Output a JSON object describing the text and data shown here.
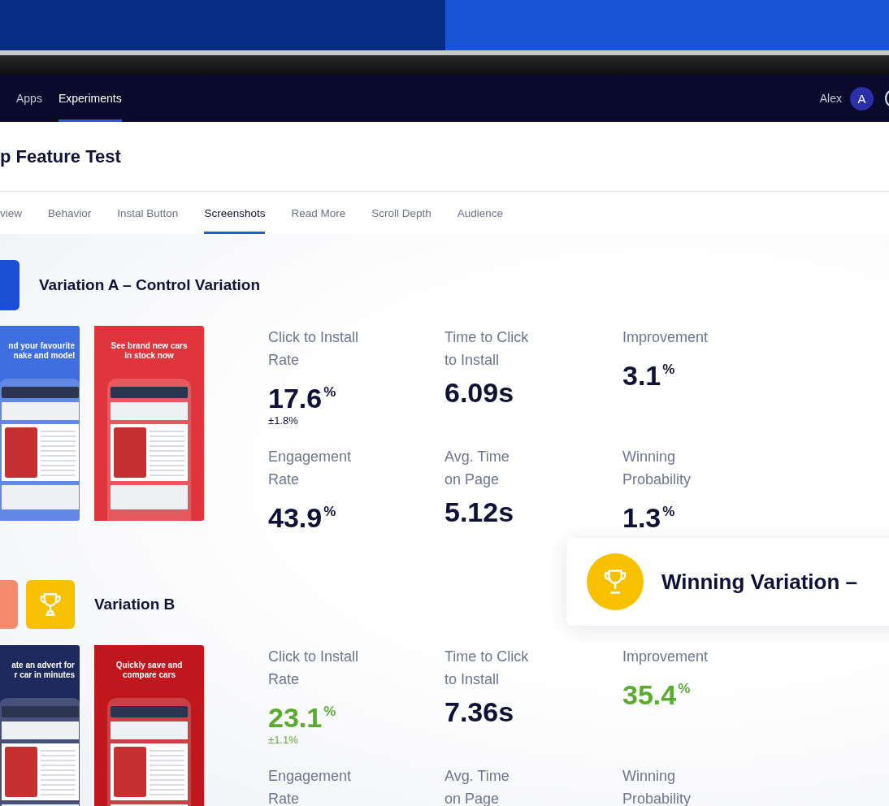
{
  "nav": {
    "items": [
      {
        "label": "Apps",
        "selected": false
      },
      {
        "label": "Experiments",
        "selected": true
      }
    ],
    "user": "Alex",
    "avatar": "A"
  },
  "page_title": "p Feature Test",
  "tabs": [
    {
      "label": "view",
      "selected": false
    },
    {
      "label": "Behavior",
      "selected": false
    },
    {
      "label": "Instal Button",
      "selected": false
    },
    {
      "label": "Screenshots",
      "selected": true
    },
    {
      "label": "Read More",
      "selected": false
    },
    {
      "label": "Scroll Depth",
      "selected": false
    },
    {
      "label": "Audience",
      "selected": false
    }
  ],
  "variations": [
    {
      "title": "Variation A – Control Variation",
      "color": "#1c4fd6",
      "trophy": false,
      "screenshots": [
        {
          "caption": "nd your favourite\nnake and model",
          "color": "#3f6fde"
        },
        {
          "caption": "See brand new cars\nin stock now",
          "color": "#e0353c"
        }
      ],
      "metrics": [
        {
          "label": "Click to Install\nRate",
          "value": "17.6",
          "unit": "%",
          "margin": "±1.8%",
          "positive": false
        },
        {
          "label": "Time to Click\nto Install",
          "value": "6.09s",
          "positive": false
        },
        {
          "label": "Improvement",
          "value": "3.1",
          "unit": "%",
          "positive": false
        },
        {
          "label": "Engagement\nRate",
          "value": "43.9",
          "unit": "%",
          "positive": false
        },
        {
          "label": "Avg. Time\non Page",
          "value": "5.12s",
          "positive": false
        },
        {
          "label": "Winning\nProbability",
          "value": "1.3",
          "unit": "%",
          "positive": false
        }
      ]
    },
    {
      "title": "Variation B",
      "color": "#f58a6c",
      "trophy": true,
      "screenshots": [
        {
          "caption": "ate an advert for\nr car in minutes",
          "color": "#1e2a5e"
        },
        {
          "caption": "Quickly save and\ncompare cars",
          "color": "#c0161d"
        }
      ],
      "metrics": [
        {
          "label": "Click to Install\nRate",
          "value": "23.1",
          "unit": "%",
          "margin": "±1.1%",
          "positive": true
        },
        {
          "label": "Time to Click\nto Install",
          "value": "7.36s",
          "positive": false
        },
        {
          "label": "Improvement",
          "value": "35.4",
          "unit": "%",
          "positive": true
        },
        {
          "label": "Engagement\nRate"
        },
        {
          "label": "Avg. Time\non Page"
        },
        {
          "label": "Winning\nProbability"
        }
      ]
    }
  ],
  "winner_card": {
    "title": "Winning Variation –"
  }
}
